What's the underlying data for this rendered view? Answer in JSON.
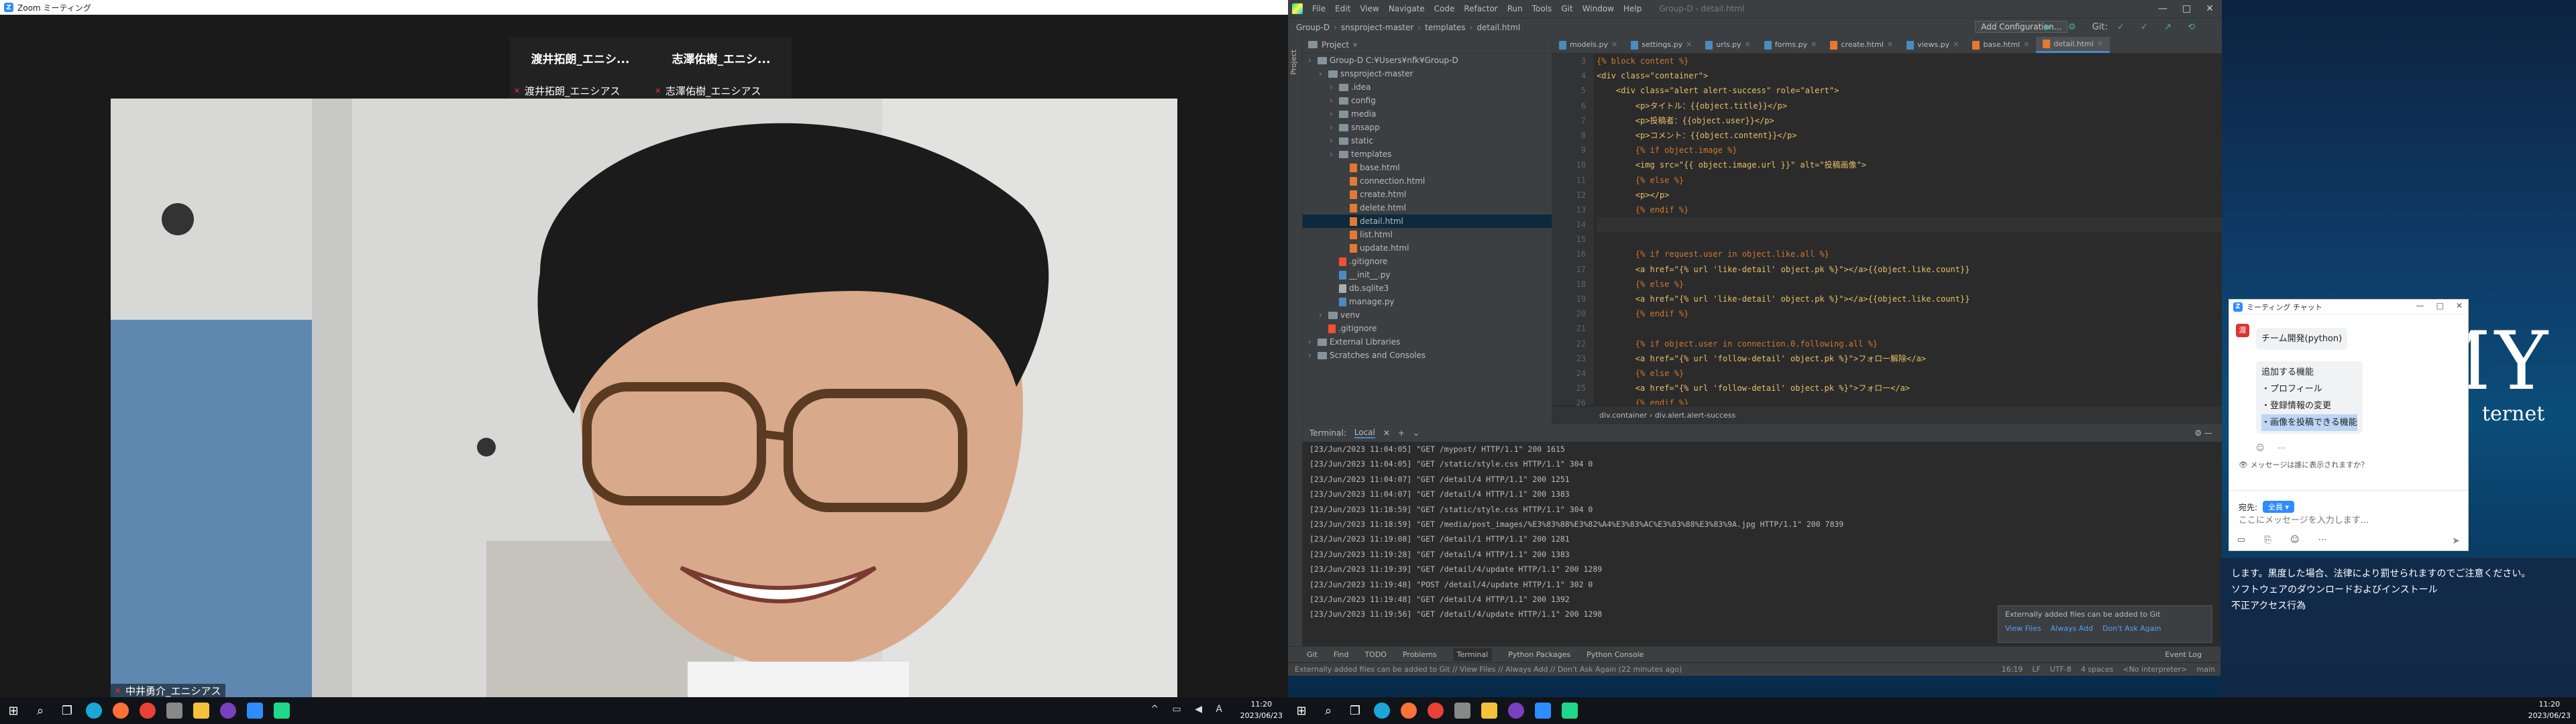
{
  "zoom": {
    "window_title": "Zoom ミーティング",
    "tiles": [
      {
        "name": "渡井拓朗_エニシ...",
        "label": "渡井拓朗_エニシアス"
      },
      {
        "name": "志澤佑樹_エニシ...",
        "label": "志澤佑樹_エニシアス"
      }
    ],
    "speaker_label": "中井勇介_エニシアス"
  },
  "taskbar_left": {
    "time": "11:20",
    "date": "2023/06/23",
    "ime": "A",
    "apps": [
      "start-icon",
      "search-icon",
      "taskview-icon",
      "edge-icon",
      "firefox-icon",
      "chrome-icon",
      "settings-icon",
      "explorer-icon",
      "app-icon",
      "zoom-icon",
      "pycharm-icon"
    ]
  },
  "taskbar_right": {
    "time": "11:20",
    "date": "2023/06/23"
  },
  "desktop": {
    "wallpaper_text": "MY",
    "wallpaper_sub": "ternet"
  },
  "ide": {
    "menu": [
      "File",
      "Edit",
      "View",
      "Navigate",
      "Code",
      "Refactor",
      "Run",
      "Tools",
      "Git",
      "Window",
      "Help"
    ],
    "title_hint": "Group-D - detail.html",
    "breadcrumb_nav": [
      "Group-D",
      "snsproject-master",
      "templates",
      "detail.html"
    ],
    "run_config": "Add Configuration...",
    "git_label": "Git:",
    "project_label": "Project",
    "tree": [
      {
        "indent": 0,
        "type": "folder",
        "label": "Group-D  C:¥Users¥nfk¥Group-D"
      },
      {
        "indent": 1,
        "type": "folder",
        "label": "snsproject-master"
      },
      {
        "indent": 2,
        "type": "folder",
        "label": ".idea"
      },
      {
        "indent": 2,
        "type": "folder",
        "label": "config"
      },
      {
        "indent": 2,
        "type": "folder",
        "label": "media"
      },
      {
        "indent": 2,
        "type": "folder",
        "label": "snsapp"
      },
      {
        "indent": 2,
        "type": "folder",
        "label": "static"
      },
      {
        "indent": 2,
        "type": "folder",
        "label": "templates"
      },
      {
        "indent": 3,
        "type": "html",
        "label": "base.html"
      },
      {
        "indent": 3,
        "type": "html",
        "label": "connection.html"
      },
      {
        "indent": 3,
        "type": "html",
        "label": "create.html"
      },
      {
        "indent": 3,
        "type": "html",
        "label": "delete.html"
      },
      {
        "indent": 3,
        "type": "html",
        "label": "detail.html",
        "selected": true
      },
      {
        "indent": 3,
        "type": "html",
        "label": "list.html"
      },
      {
        "indent": 3,
        "type": "html",
        "label": "update.html"
      },
      {
        "indent": 2,
        "type": "git",
        "label": ".gitignore"
      },
      {
        "indent": 2,
        "type": "py",
        "label": "__init__.py"
      },
      {
        "indent": 2,
        "type": "db",
        "label": "db.sqlite3"
      },
      {
        "indent": 2,
        "type": "py",
        "label": "manage.py"
      },
      {
        "indent": 1,
        "type": "folder",
        "label": "venv"
      },
      {
        "indent": 1,
        "type": "git",
        "label": ".gitignore"
      },
      {
        "indent": 0,
        "type": "folder",
        "label": "External Libraries"
      },
      {
        "indent": 0,
        "type": "folder",
        "label": "Scratches and Consoles"
      }
    ],
    "tabs": [
      {
        "label": "models.py"
      },
      {
        "label": "settings.py"
      },
      {
        "label": "urls.py"
      },
      {
        "label": "forms.py"
      },
      {
        "label": "create.html"
      },
      {
        "label": "views.py"
      },
      {
        "label": "base.html"
      },
      {
        "label": "detail.html",
        "active": true
      }
    ],
    "line_numbers": [
      "3",
      "4",
      "5",
      "6",
      "7",
      "8",
      "9",
      "10",
      "11",
      "12",
      "13",
      "14",
      "15",
      "16",
      "17",
      "18",
      "19",
      "20",
      "21",
      "22",
      "23",
      "24",
      "25",
      "26"
    ],
    "code_lines": [
      "{% block content %}",
      "<div class=\"container\">",
      "    <div class=\"alert alert-success\" role=\"alert\">",
      "        <p>タイトル：{{object.title}}</p>",
      "        <p>投稿者：{{object.user}}</p>",
      "        <p>コメント：{{object.content}}</p>",
      "        {% if object.image %}",
      "        <img src=\"{{ object.image.url }}\" alt=\"投稿画像\">",
      "        {% else %}",
      "        <p></p>",
      "        {% endif %}",
      "",
      "",
      "        {% if request.user in object.like.all %}",
      "        <a href=\"{% url 'like-detail' object.pk %}\"></a>{{object.like.count}}",
      "        {% else %}",
      "        <a href=\"{% url 'like-detail' object.pk %}\"></a>{{object.like.count}}",
      "        {% endif %}",
      "",
      "        {% if object.user in connection.0.following.all %}",
      "        <a href=\"{% url 'follow-detail' object.pk %}\">フォロー解除</a>",
      "        {% else %}",
      "        <a href=\"{% url 'follow-detail' object.pk %}\">フォロー</a>",
      "        {% endif %}"
    ],
    "editor_breadcrumb": "div.container  ›  div.alert.alert-success",
    "terminal_tabs": [
      "Terminal:",
      "Local"
    ],
    "terminal_lines": [
      "[23/Jun/2023 11:04:05] \"GET /mypost/ HTTP/1.1\" 200 1615",
      "[23/Jun/2023 11:04:05] \"GET /static/style.css HTTP/1.1\" 304 0",
      "[23/Jun/2023 11:04:07] \"GET /detail/4 HTTP/1.1\" 200 1251",
      "[23/Jun/2023 11:04:07] \"GET /detail/4 HTTP/1.1\" 200 1383",
      "[23/Jun/2023 11:18:59] \"GET /static/style.css HTTP/1.1\" 304 0",
      "[23/Jun/2023 11:18:59] \"GET /media/post_images/%E3%83%88%E3%82%A4%E3%83%AC%E3%83%88%E3%83%9A.jpg HTTP/1.1\" 200 7839",
      "[23/Jun/2023 11:19:08] \"GET /detail/1 HTTP/1.1\" 200 1281",
      "[23/Jun/2023 11:19:28] \"GET /detail/4 HTTP/1.1\" 200 1383",
      "[23/Jun/2023 11:19:39] \"GET /detail/4/update HTTP/1.1\" 200 1289",
      "[23/Jun/2023 11:19:48] \"POST /detail/4/update HTTP/1.1\" 302 0",
      "[23/Jun/2023 11:19:48] \"GET /detail/4 HTTP/1.1\" 200 1392",
      "[23/Jun/2023 11:19:56] \"GET /detail/4/update HTTP/1.1\" 200 1298"
    ],
    "git_notice": {
      "text": "Externally added files can be added to Git",
      "actions": [
        "View Files",
        "Always Add",
        "Don't Ask Again"
      ]
    },
    "bottom_tabs": [
      "Git",
      "Find",
      "TODO",
      "Problems",
      "Terminal",
      "Python Packages",
      "Python Console"
    ],
    "event_log": "Event Log",
    "status_text": "Externally added files can be added to Git // View Files // Always Add // Don't Ask Again (22 minutes ago)",
    "status_right": [
      "16:19",
      "LF",
      "UTF-8",
      "4 spaces",
      "<No interpreter>",
      "main"
    ]
  },
  "chat": {
    "title": "ミーティング チャット",
    "bubble_header": "チーム開発(python)",
    "bubble_lines": [
      "追加する機能",
      "・プロフィール",
      "・登録情報の変更",
      "・画像を投稿できる機能"
    ],
    "selected_index": 3,
    "visibility_note": "メッセージは誰に表示されますか？",
    "to_label": "宛先:",
    "to_value": "全員",
    "input_placeholder": "ここにメッセージを入力します..."
  },
  "notify": {
    "lines": [
      "します。黒度した場合、法律により罰せられますのでご注意ください。",
      "ソフトウェアのダウンロードおよびインストール",
      "不正アクセス行為"
    ]
  }
}
